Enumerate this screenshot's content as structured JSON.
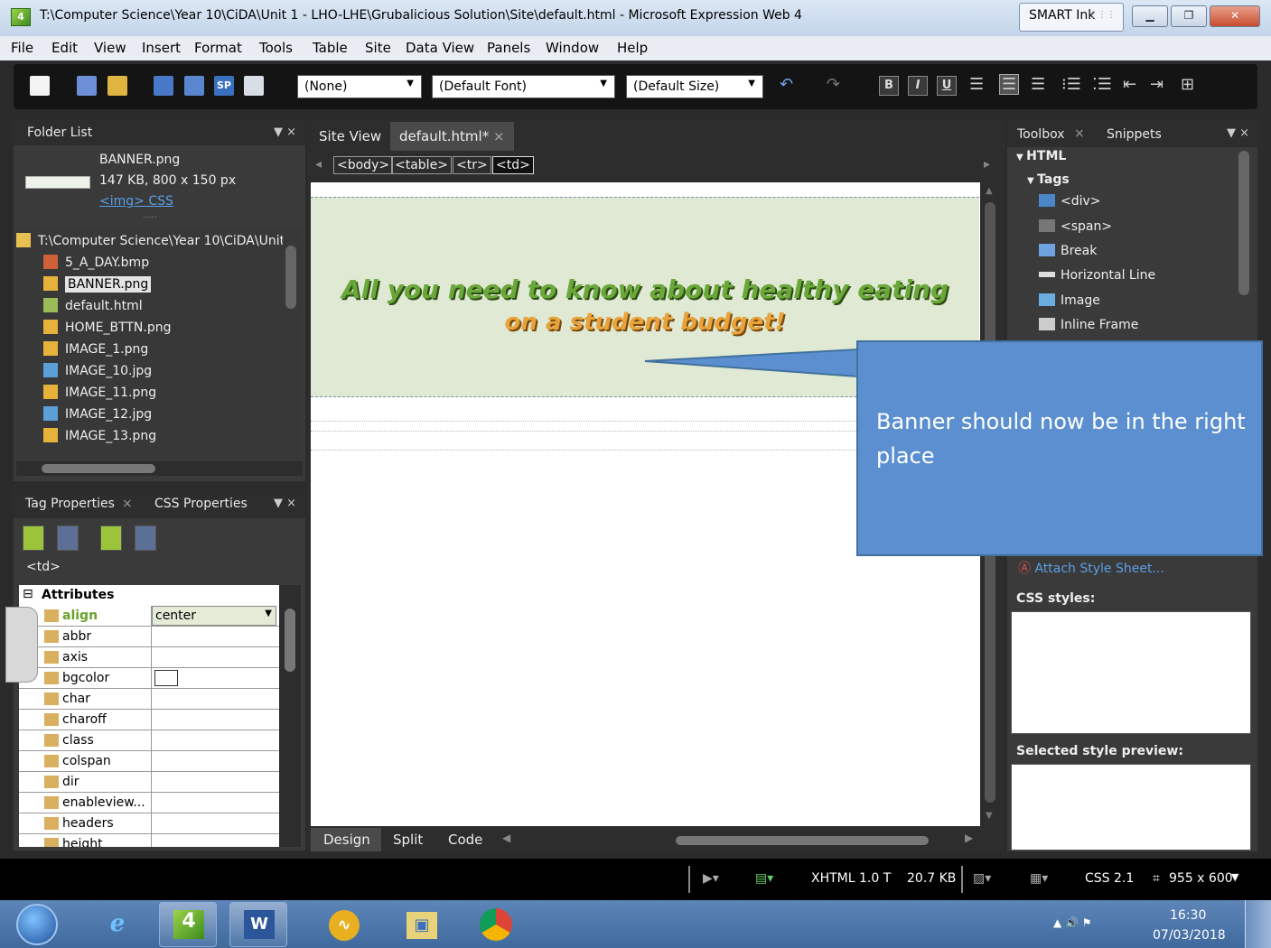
{
  "window": {
    "title": "T:\\Computer Science\\Year 10\\CiDA\\Unit 1 - LHO-LHE\\Grubalicious Solution\\Site\\default.html - Microsoft Expression Web 4",
    "app_icon": "4",
    "smart_ink": "SMART Ink",
    "smart_ink_grip": "⋮⋮⋮",
    "min": "▁",
    "max": "❐",
    "close": "✕"
  },
  "menu": [
    "File",
    "Edit",
    "View",
    "Insert",
    "Format",
    "Tools",
    "Table",
    "Site",
    "Data View",
    "Panels",
    "Window",
    "Help"
  ],
  "toolbar": {
    "style_combo": "(None)",
    "font_combo": "(Default Font)",
    "size_combo": "(Default Size)",
    "bold": "B",
    "italic": "I",
    "underline": "U"
  },
  "folder_panel": {
    "title": "Folder List",
    "pin": "▼ ×",
    "preview": {
      "name": "BANNER.png",
      "info": "147 KB, 800 x 150 px",
      "links": "<img> CSS",
      "dots": "....."
    },
    "root": "T:\\Computer Science\\Year 10\\CiDA\\Unit",
    "files": [
      "5_A_DAY.bmp",
      "BANNER.png",
      "default.html",
      "HOME_BTTN.png",
      "IMAGE_1.png",
      "IMAGE_10.jpg",
      "IMAGE_11.png",
      "IMAGE_12.jpg",
      "IMAGE_13.png"
    ]
  },
  "tag_panel": {
    "tab1": "Tag Properties",
    "tab2": "CSS Properties",
    "close": "×",
    "pin": "▼ ×",
    "tag": "<td>",
    "section": "Attributes",
    "collapse": "⊟",
    "attrs": [
      {
        "name": "align",
        "value": "center"
      },
      {
        "name": "abbr",
        "value": ""
      },
      {
        "name": "axis",
        "value": ""
      },
      {
        "name": "bgcolor",
        "value": ""
      },
      {
        "name": "char",
        "value": ""
      },
      {
        "name": "charoff",
        "value": ""
      },
      {
        "name": "class",
        "value": ""
      },
      {
        "name": "colspan",
        "value": ""
      },
      {
        "name": "dir",
        "value": ""
      },
      {
        "name": "enableview...",
        "value": ""
      },
      {
        "name": "headers",
        "value": ""
      },
      {
        "name": "height",
        "value": ""
      }
    ]
  },
  "editor": {
    "tab_site": "Site View",
    "tab_doc": "default.html*",
    "tab_close": "×",
    "breadcrumbs": [
      "<body>",
      "<table>",
      "<tr>",
      "<td>"
    ],
    "banner_line1": "All you need to know about healthy eating",
    "banner_line2": "on a student budget!",
    "view_tabs": [
      "Design",
      "Split",
      "Code"
    ]
  },
  "toolbox": {
    "tab1": "Toolbox",
    "tab2": "Snippets",
    "close": "×",
    "pin": "▼ ×",
    "section": "HTML",
    "subsection": "Tags",
    "items": [
      "<div>",
      "<span>",
      "Break",
      "Horizontal Line",
      "Image",
      "Inline Frame"
    ],
    "attach": "Attach Style Sheet...",
    "css_styles": "CSS styles:",
    "preview": "Selected style preview:"
  },
  "callout": {
    "text": "Banner should now be in the right place"
  },
  "status": {
    "doctype": "XHTML 1.0 T",
    "size": "20.7 KB",
    "css": "CSS 2.1",
    "dims": "955 x 600",
    "dims_icon": "⌗"
  },
  "taskbar": {
    "time": "16:30",
    "date": "07/03/2018",
    "tray": "▲  🔊  ⚑"
  }
}
